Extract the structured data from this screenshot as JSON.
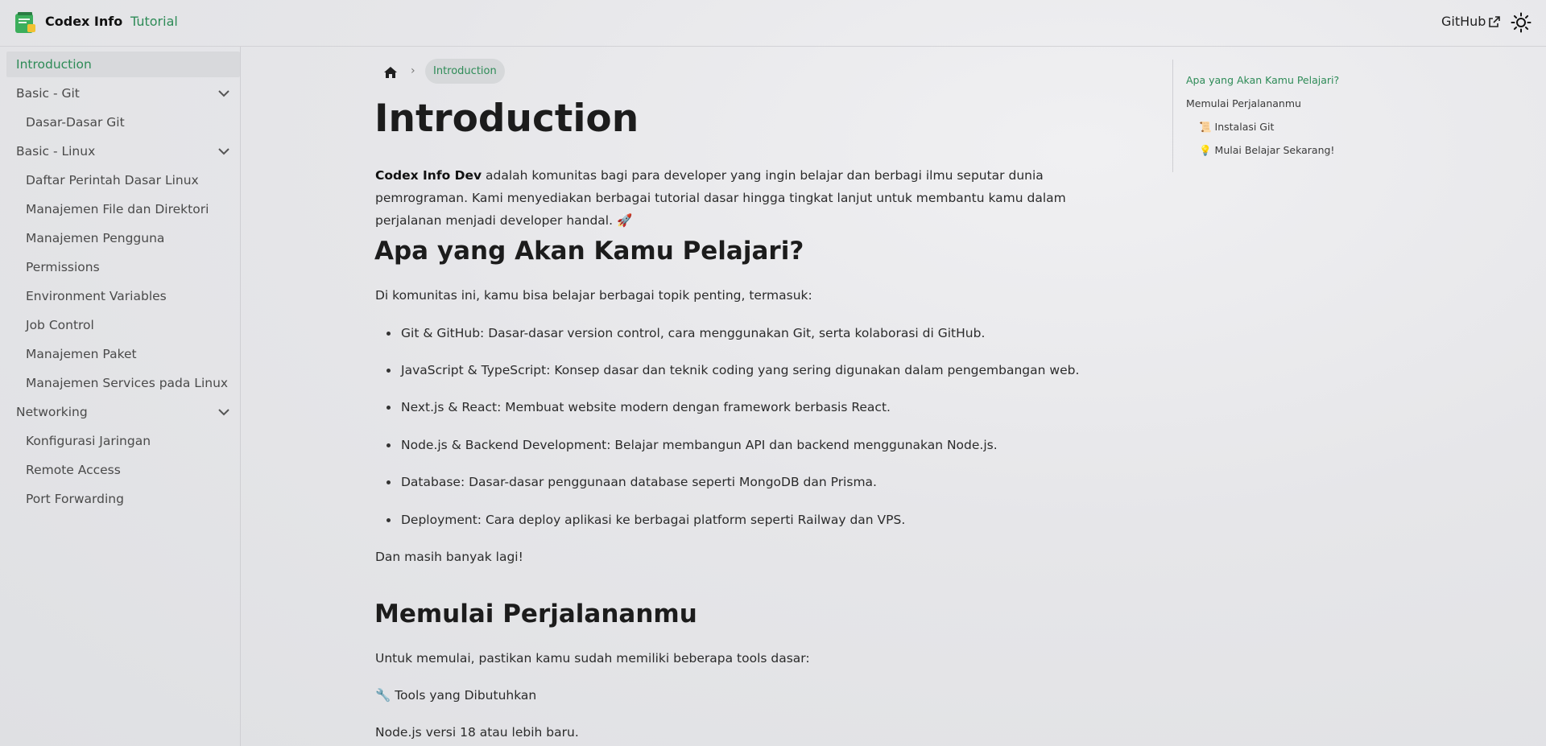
{
  "header": {
    "brand": "Codex Info",
    "nav_tutorial": "Tutorial",
    "github": "GitHub"
  },
  "sidebar": {
    "items": [
      {
        "label": "Introduction"
      },
      {
        "label": "Basic - Git"
      },
      {
        "label": "Dasar-Dasar Git"
      },
      {
        "label": "Basic - Linux"
      },
      {
        "label": "Daftar Perintah Dasar Linux"
      },
      {
        "label": "Manajemen File dan Direktori"
      },
      {
        "label": "Manajemen Pengguna"
      },
      {
        "label": "Permissions"
      },
      {
        "label": "Environment Variables"
      },
      {
        "label": "Job Control"
      },
      {
        "label": "Manajemen Paket"
      },
      {
        "label": "Manajemen Services pada Linux"
      },
      {
        "label": "Networking"
      },
      {
        "label": "Konfigurasi Jaringan"
      },
      {
        "label": "Remote Access"
      },
      {
        "label": "Port Forwarding"
      }
    ]
  },
  "breadcrumb": {
    "current": "Introduction"
  },
  "main": {
    "title": "Introduction",
    "intro_bold": "Codex Info Dev",
    "intro_rest": " adalah komunitas bagi para developer yang ingin belajar dan berbagi ilmu seputar dunia pemrograman. Kami menyediakan berbagai tutorial dasar hingga tingkat lanjut untuk membantu kamu dalam perjalanan menjadi developer handal. 🚀",
    "h2_learn": "Apa yang Akan Kamu Pelajari?",
    "learn_intro": "Di komunitas ini, kamu bisa belajar berbagai topik penting, termasuk:",
    "bullets": [
      "Git & GitHub: Dasar-dasar version control, cara menggunakan Git, serta kolaborasi di GitHub.",
      "JavaScript & TypeScript: Konsep dasar dan teknik coding yang sering digunakan dalam pengembangan web.",
      "Next.js & React: Membuat website modern dengan framework berbasis React.",
      "Node.js & Backend Development: Belajar membangun API dan backend menggunakan Node.js.",
      "Database: Dasar-dasar penggunaan database seperti MongoDB dan Prisma.",
      "Deployment: Cara deploy aplikasi ke berbagai platform seperti Railway dan VPS."
    ],
    "more": "Dan masih banyak lagi!",
    "h2_start": "Memulai Perjalananmu",
    "start_intro": "Untuk memulai, pastikan kamu sudah memiliki beberapa tools dasar:",
    "tools": "🔧 Tools yang Dibutuhkan",
    "node_req": "Node.js versi 18 atau lebih baru."
  },
  "toc": {
    "items": [
      "Apa yang Akan Kamu Pelajari?",
      "Memulai Perjalananmu",
      "📜 Instalasi Git",
      "💡 Mulai Belajar Sekarang!"
    ]
  },
  "colors": {
    "accent": "#2e8b57"
  }
}
